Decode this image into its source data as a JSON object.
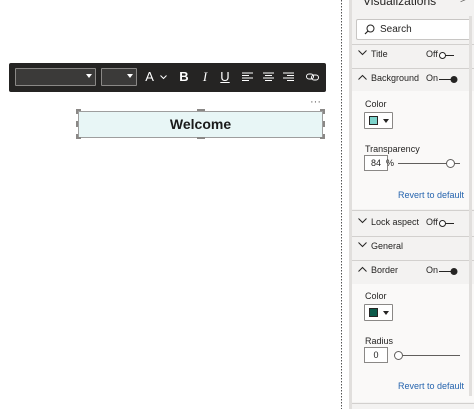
{
  "toolbar": {
    "font_family_value": "",
    "font_size_value": "",
    "font_color_label": "A",
    "bold_label": "B",
    "italic_label": "I",
    "underline_label": "U",
    "icons": [
      "font-color-icon",
      "bold-icon",
      "italic-icon",
      "underline-icon",
      "align-left-icon",
      "align-center-icon",
      "align-right-icon",
      "link-icon"
    ]
  },
  "textbox": {
    "more_options": "···",
    "text": "Welcome",
    "fill_color": "#e8f6f6"
  },
  "pane": {
    "title": "Visualizations",
    "search_placeholder": "Search",
    "sections": {
      "title": {
        "label": "Title",
        "state": "Off",
        "on": false,
        "expanded": false
      },
      "background": {
        "label": "Background",
        "state": "On",
        "on": true,
        "expanded": true
      },
      "lock_aspect": {
        "label": "Lock aspect",
        "state": "Off",
        "on": false,
        "expanded": false
      },
      "general": {
        "label": "General",
        "expanded": false
      },
      "border": {
        "label": "Border",
        "state": "On",
        "on": true,
        "expanded": true
      }
    },
    "background": {
      "color_label": "Color",
      "color_value": "#7dd3cb",
      "transparency_label": "Transparency",
      "transparency_value": "84",
      "transparency_unit": "%",
      "transparency_level": 0.84,
      "revert_label": "Revert to default"
    },
    "border": {
      "color_label": "Color",
      "color_value": "#0c5a4a",
      "radius_label": "Radius",
      "radius_value": "0",
      "radius_level": 0,
      "revert_label": "Revert to default"
    }
  },
  "colors": {
    "toolbar_bg": "#252423",
    "pane_bg": "#f3f2f1",
    "link": "#2564ae"
  }
}
